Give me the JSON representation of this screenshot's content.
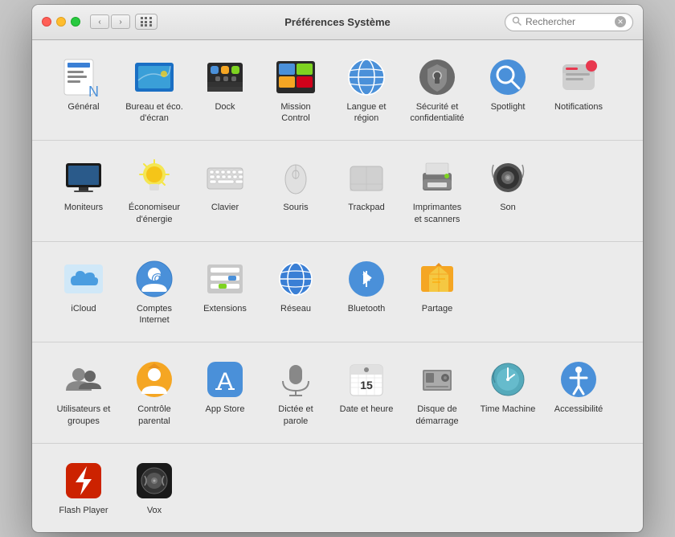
{
  "window": {
    "title": "Préférences Système",
    "search_placeholder": "Rechercher"
  },
  "sections": [
    {
      "id": "section1",
      "items": [
        {
          "id": "general",
          "label": "Général",
          "icon": "general"
        },
        {
          "id": "bureau",
          "label": "Bureau et\néco. d'écran",
          "icon": "bureau"
        },
        {
          "id": "dock",
          "label": "Dock",
          "icon": "dock"
        },
        {
          "id": "mission",
          "label": "Mission\nControl",
          "icon": "mission"
        },
        {
          "id": "langue",
          "label": "Langue et\nrégion",
          "icon": "langue"
        },
        {
          "id": "securite",
          "label": "Sécurité\net confidentialité",
          "icon": "securite"
        },
        {
          "id": "spotlight",
          "label": "Spotlight",
          "icon": "spotlight"
        },
        {
          "id": "notifications",
          "label": "Notifications",
          "icon": "notifications"
        }
      ]
    },
    {
      "id": "section2",
      "items": [
        {
          "id": "moniteurs",
          "label": "Moniteurs",
          "icon": "moniteurs"
        },
        {
          "id": "economiseur",
          "label": "Économiseur\nd'énergie",
          "icon": "economiseur"
        },
        {
          "id": "clavier",
          "label": "Clavier",
          "icon": "clavier"
        },
        {
          "id": "souris",
          "label": "Souris",
          "icon": "souris"
        },
        {
          "id": "trackpad",
          "label": "Trackpad",
          "icon": "trackpad"
        },
        {
          "id": "imprimantes",
          "label": "Imprimantes et\nscanners",
          "icon": "imprimantes"
        },
        {
          "id": "son",
          "label": "Son",
          "icon": "son"
        }
      ]
    },
    {
      "id": "section3",
      "items": [
        {
          "id": "icloud",
          "label": "iCloud",
          "icon": "icloud"
        },
        {
          "id": "comptes",
          "label": "Comptes\nInternet",
          "icon": "comptes"
        },
        {
          "id": "extensions",
          "label": "Extensions",
          "icon": "extensions"
        },
        {
          "id": "reseau",
          "label": "Réseau",
          "icon": "reseau"
        },
        {
          "id": "bluetooth",
          "label": "Bluetooth",
          "icon": "bluetooth"
        },
        {
          "id": "partage",
          "label": "Partage",
          "icon": "partage"
        }
      ]
    },
    {
      "id": "section4",
      "items": [
        {
          "id": "utilisateurs",
          "label": "Utilisateurs et\ngroupes",
          "icon": "utilisateurs"
        },
        {
          "id": "controle",
          "label": "Contrôle\nparental",
          "icon": "controle"
        },
        {
          "id": "appstore",
          "label": "App Store",
          "icon": "appstore"
        },
        {
          "id": "dictee",
          "label": "Dictée\net parole",
          "icon": "dictee"
        },
        {
          "id": "date",
          "label": "Date et heure",
          "icon": "date"
        },
        {
          "id": "disque",
          "label": "Disque de\ndémarrage",
          "icon": "disque"
        },
        {
          "id": "timemachine",
          "label": "Time\nMachine",
          "icon": "timemachine"
        },
        {
          "id": "accessibilite",
          "label": "Accessibilité",
          "icon": "accessibilite"
        }
      ]
    },
    {
      "id": "section5",
      "items": [
        {
          "id": "flashplayer",
          "label": "Flash Player",
          "icon": "flashplayer"
        },
        {
          "id": "vox",
          "label": "Vox",
          "icon": "vox"
        }
      ]
    }
  ]
}
